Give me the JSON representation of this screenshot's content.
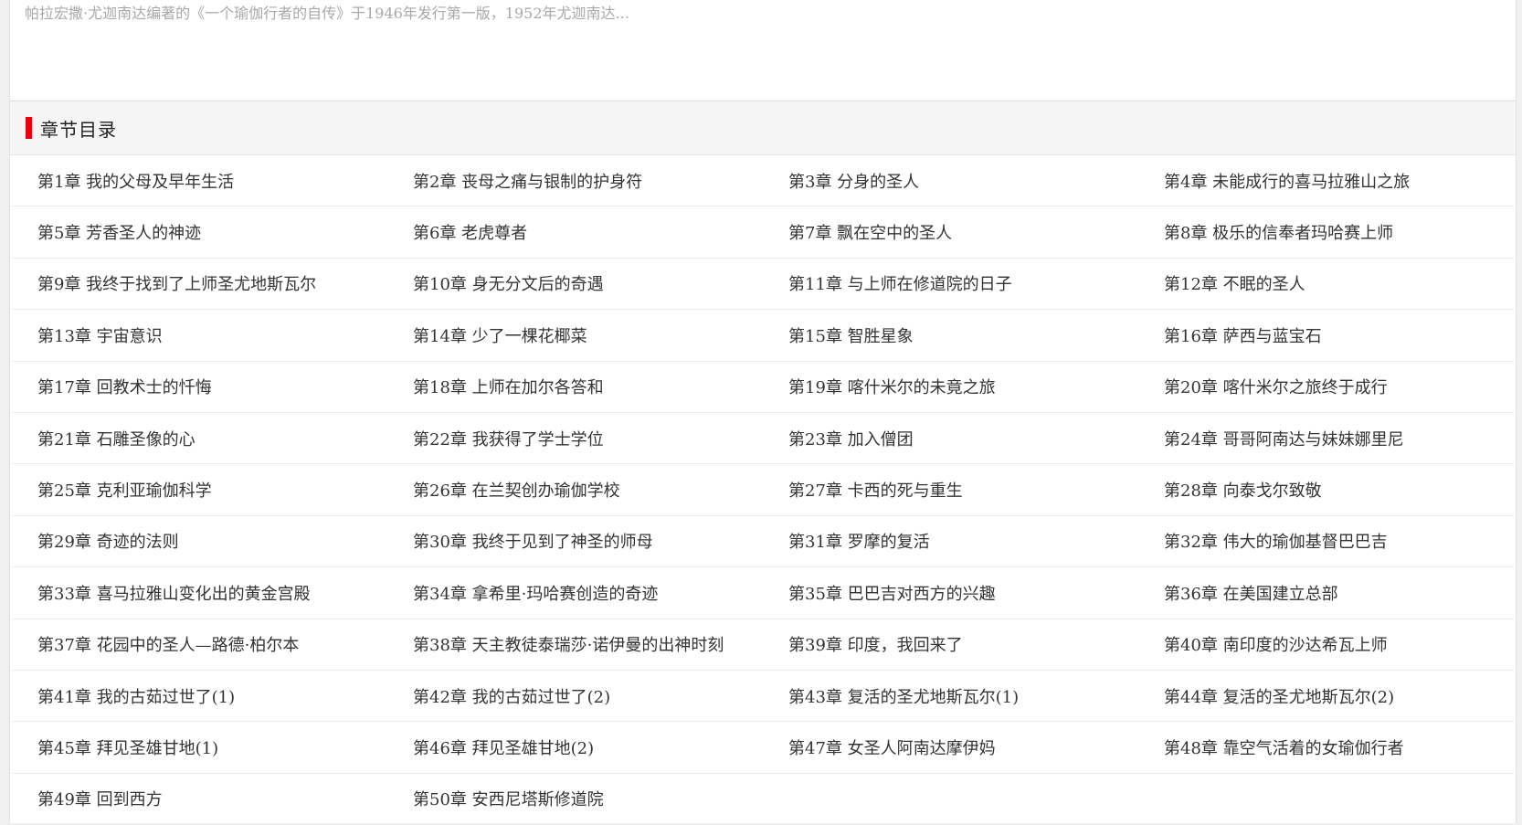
{
  "book": {
    "description": "帕拉宏撒·尤迦南达编著的《一个瑜伽行者的自传》于1946年发行第一版，1952年尤迦南达..."
  },
  "section": {
    "title": "章节目录"
  },
  "chapters": [
    "第1章 我的父母及早年生活",
    "第2章 丧母之痛与银制的护身符",
    "第3章 分身的圣人",
    "第4章 未能成行的喜马拉雅山之旅",
    "第5章 芳香圣人的神迹",
    "第6章 老虎尊者",
    "第7章 飘在空中的圣人",
    "第8章 极乐的信奉者玛哈赛上师",
    "第9章 我终于找到了上师圣尤地斯瓦尔",
    "第10章 身无分文后的奇遇",
    "第11章 与上师在修道院的日子",
    "第12章 不眠的圣人",
    "第13章 宇宙意识",
    "第14章 少了一棵花椰菜",
    "第15章 智胜星象",
    "第16章 萨西与蓝宝石",
    "第17章 回教术士的忏悔",
    "第18章 上师在加尔各答和",
    "第19章 喀什米尔的未竟之旅",
    "第20章 喀什米尔之旅终于成行",
    "第21章 石雕圣像的心",
    "第22章 我获得了学士学位",
    "第23章 加入僧团",
    "第24章 哥哥阿南达与妹妹娜里尼",
    "第25章 克利亚瑜伽科学",
    "第26章 在兰契创办瑜伽学校",
    "第27章 卡西的死与重生",
    "第28章 向泰戈尔致敬",
    "第29章 奇迹的法则",
    "第30章 我终于见到了神圣的师母",
    "第31章 罗摩的复活",
    "第32章 伟大的瑜伽基督巴巴吉",
    "第33章 喜马拉雅山变化出的黄金宫殿",
    "第34章 拿希里·玛哈赛创造的奇迹",
    "第35章 巴巴吉对西方的兴趣",
    "第36章 在美国建立总部",
    "第37章 花园中的圣人—路德·柏尔本",
    "第38章 天主教徒泰瑞莎·诺伊曼的出神时刻",
    "第39章 印度，我回来了",
    "第40章 南印度的沙达希瓦上师",
    "第41章 我的古茹过世了(1)",
    "第42章 我的古茹过世了(2)",
    "第43章 复活的圣尤地斯瓦尔(1)",
    "第44章 复活的圣尤地斯瓦尔(2)",
    "第45章 拜见圣雄甘地(1)",
    "第46章 拜见圣雄甘地(2)",
    "第47章 女圣人阿南达摩伊妈",
    "第48章 靠空气活着的女瑜伽行者",
    "第49章 回到西方",
    "第50章 安西尼塔斯修道院"
  ]
}
